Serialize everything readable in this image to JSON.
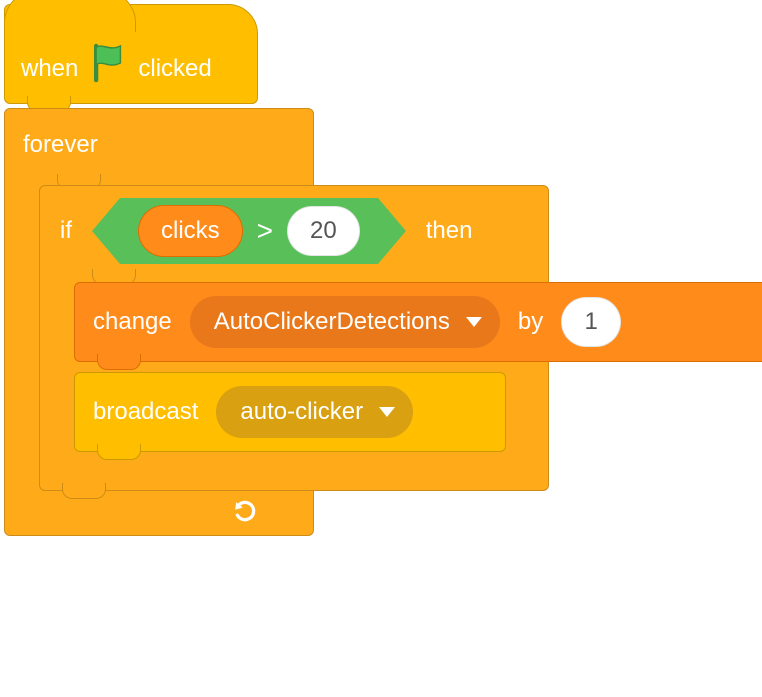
{
  "hat": {
    "when": "when",
    "clicked": "clicked",
    "flag_color": "#4cbf56"
  },
  "forever": {
    "label": "forever"
  },
  "if_block": {
    "if": "if",
    "then": "then"
  },
  "condition": {
    "var": "clicks",
    "op": ">",
    "value": "20"
  },
  "change": {
    "label_change": "change",
    "variable": "AutoClickerDetections",
    "label_by": "by",
    "amount": "1"
  },
  "broadcast": {
    "label": "broadcast",
    "message": "auto-clicker"
  }
}
